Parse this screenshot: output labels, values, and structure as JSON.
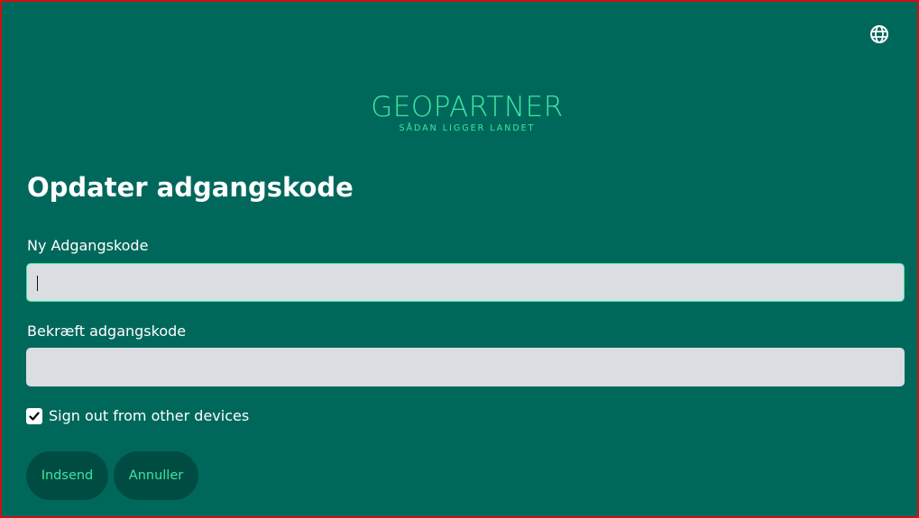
{
  "header": {
    "language_icon": "globe-icon"
  },
  "logo": {
    "brand": "GEOPARTNER",
    "tagline": "SÅDAN LIGGER LANDET"
  },
  "form": {
    "title": "Opdater adgangskode",
    "new_password": {
      "label": "Ny Adgangskode",
      "value": "",
      "placeholder": ""
    },
    "confirm_password": {
      "label": "Bekræft adgangskode",
      "value": "",
      "placeholder": ""
    },
    "sign_out_other": {
      "label": "Sign out from other devices",
      "checked": true
    },
    "submit_label": "Indsend",
    "cancel_label": "Annuller"
  },
  "colors": {
    "background": "#00685b",
    "accent": "#3ee6a1",
    "button_bg": "#004c42",
    "field_bg": "#dadde2",
    "frame_border": "#d01010"
  }
}
